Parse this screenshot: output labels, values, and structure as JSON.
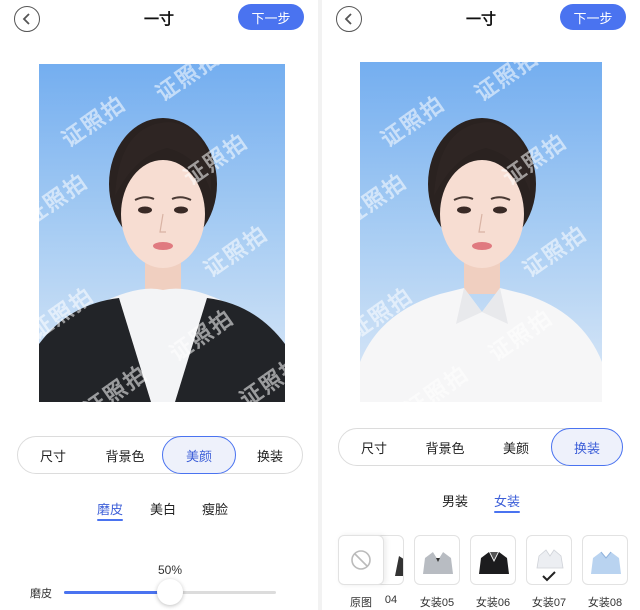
{
  "left": {
    "title": "一寸",
    "next_label": "下一步",
    "watermark": "证照拍",
    "tabs": [
      "尺寸",
      "背景色",
      "美颜",
      "换装"
    ],
    "active_tab": "美颜",
    "subtabs": [
      "磨皮",
      "美白",
      "瘦脸"
    ],
    "active_subtab": "磨皮",
    "slider": {
      "label": "磨皮",
      "value_text": "50%",
      "value": 0.5
    }
  },
  "right": {
    "title": "一寸",
    "next_label": "下一步",
    "watermark": "证照拍",
    "tabs": [
      "尺寸",
      "背景色",
      "美颜",
      "换装"
    ],
    "active_tab": "换装",
    "subtabs": [
      "男装",
      "女装"
    ],
    "active_subtab": "女装",
    "outfits": [
      {
        "label": "原图",
        "icon": "none-icon"
      },
      {
        "label": "04",
        "icon": "outfit-dark-suit"
      },
      {
        "label": "女装05",
        "icon": "outfit-gray-suit"
      },
      {
        "label": "女装06",
        "icon": "outfit-black-suit"
      },
      {
        "label": "女装07",
        "icon": "outfit-white-shirt",
        "selected": true
      },
      {
        "label": "女装08",
        "icon": "outfit-light-blue-shirt"
      }
    ]
  },
  "colors": {
    "accent": "#4a73f0",
    "active_tab_bg": "#eef1fb"
  }
}
